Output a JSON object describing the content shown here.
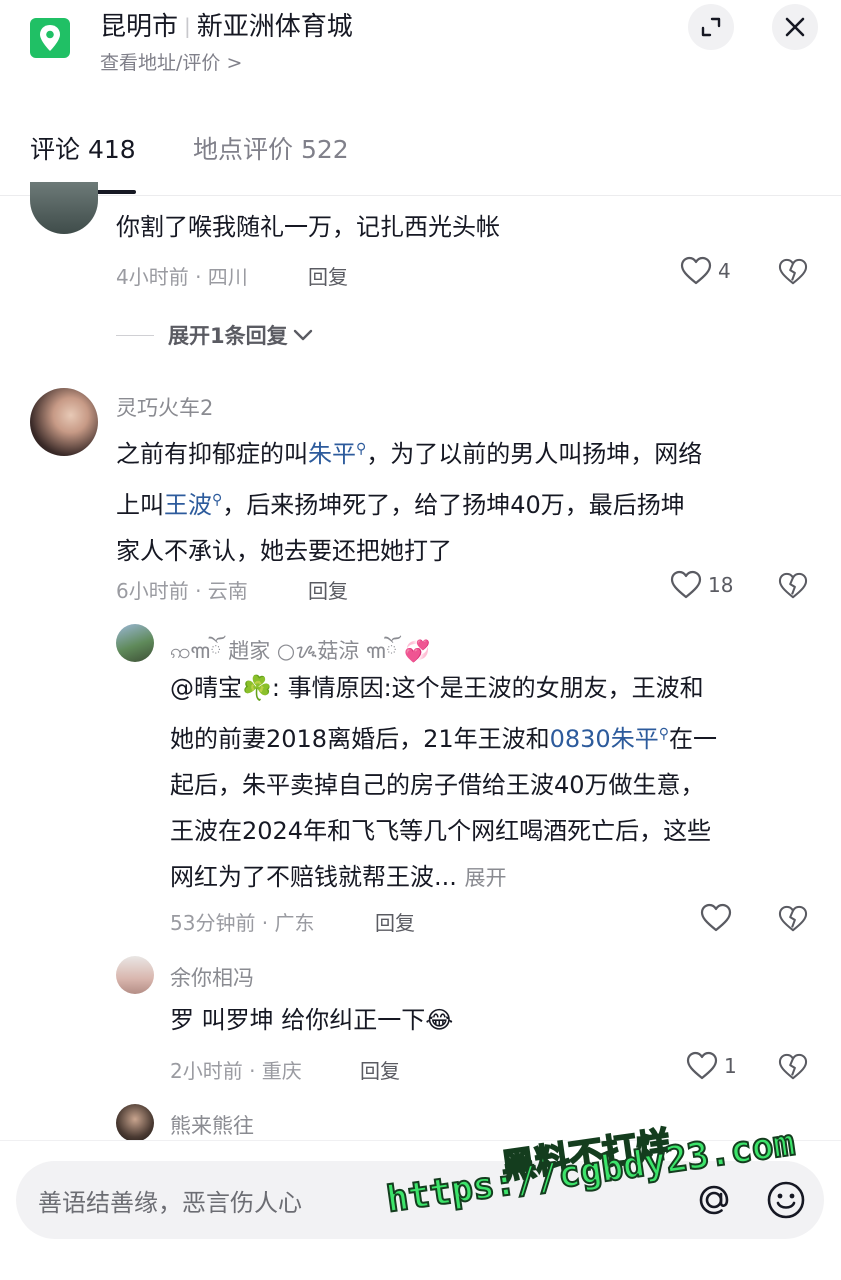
{
  "header": {
    "city": "昆明市",
    "place": "新亚洲体育城",
    "subtitle": "查看地址/评价 >",
    "icons": {
      "location": "location-pin-icon",
      "minimize": "minimize-icon",
      "close": "close-icon"
    }
  },
  "tabs": [
    {
      "label": "评论 418",
      "active": true
    },
    {
      "label": "地点评价 522",
      "active": false
    }
  ],
  "comments": [
    {
      "text": "你割了喉我随礼一万，记扎西光头帐",
      "meta": "4小时前 · 四川",
      "reply_label": "回复",
      "likes": "4"
    },
    {
      "name": "灵巧火车2",
      "text_line1_pre": "之前有抑郁症的叫",
      "text_line1_link": "朱平",
      "text_line1_post": "，为了以前的男人叫扬坤，网络",
      "text_line2_pre": "上叫",
      "text_line2_link": "王波",
      "text_line2_post": "，后来扬坤死了，给了扬坤40万，最后扬坤",
      "text_line3": "家人不承认，她去要还把她打了",
      "meta": "6小时前 · 云南",
      "reply_label": "回复",
      "likes": "18"
    }
  ],
  "more_replies": "展开1条回复",
  "replies": [
    {
      "name": "ꩡ꧑ོ 趙家 ○ᝰ菇涼 ꧑ོ 💞",
      "line1": "@晴宝☘️: 事情原因:这个是王波的女朋友，王波和",
      "line2": "她的前妻2018离婚后，21年王波和",
      "line2_link": "0830朱平",
      "line2_post": "在一",
      "line3": "起后，朱平卖掉自己的房子借给王波40万做生意，",
      "line4": "王波在2024年和飞飞等几个网红喝酒死亡后，这些",
      "line5": "网红为了不赔钱就帮王波...",
      "expand": "展开",
      "meta": "53分钟前 · 广东",
      "reply_label": "回复",
      "likes": ""
    },
    {
      "name": "余你相冯",
      "text": "罗 叫罗坤 给你纠正一下😂",
      "meta": "2小时前 · 重庆",
      "reply_label": "回复",
      "likes": "1"
    },
    {
      "name": "熊来熊往"
    }
  ],
  "input": {
    "placeholder": "善语结善缘，恶言伤人心",
    "icons": {
      "mention": "at-icon",
      "emoji": "emoji-smile-icon"
    }
  },
  "watermark": {
    "line1": "黑料不打烊",
    "line2": "https://cgbdy23.com"
  },
  "colors": {
    "accent": "#20c065",
    "link": "#2d5b9c",
    "watermark": "#3ce46a"
  }
}
